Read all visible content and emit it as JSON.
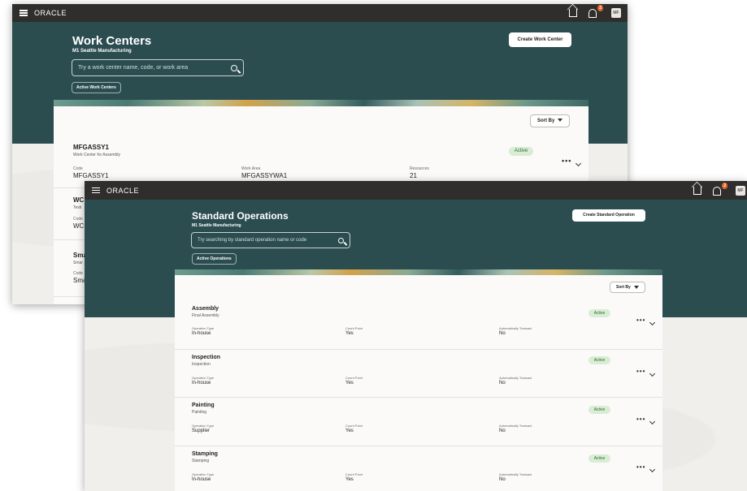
{
  "colors": {
    "topbar": "#2f2e2c",
    "hero": "#2b4d50",
    "active_bg": "#d9ecd5",
    "active_text": "#2e6b2a",
    "badge": "#e0632c"
  },
  "back": {
    "brand": "ORACLE",
    "notification_count": "2",
    "avatar": "MF",
    "title": "Work Centers",
    "subtitle": "M1 Seattle Manufacturing",
    "search_placeholder": "Try a work center name, code, or work area",
    "filter_chip": "Active Work Centers",
    "create_button": "Create Work Center",
    "sort_label": "Sort By",
    "row": {
      "name": "MFGASSY1",
      "desc": "Work Center for Assembly",
      "status": "Active",
      "code_label": "Code",
      "code": "MFGASSY1",
      "area_label": "Work Area",
      "area": "MFGASSYWA1",
      "res_label": "Resources",
      "res": "21"
    },
    "partials": [
      {
        "name": "WC",
        "desc": "Testi",
        "code_label": "Code",
        "code": "WC"
      },
      {
        "name": "Sma",
        "desc": "Smar",
        "code_label": "Code",
        "code": "Sma"
      }
    ]
  },
  "front": {
    "brand": "ORACLE",
    "notification_count": "2",
    "avatar": "MF",
    "title": "Standard Operations",
    "subtitle": "M1 Seattle Manufacturing",
    "search_placeholder": "Try searching by standard operation name or code",
    "filter_chip": "Active Operations",
    "create_button": "Create Standard Operation",
    "sort_label": "Sort By",
    "col_labels": {
      "type": "Operation Type",
      "count": "Count Point",
      "auto": "Automatically Transact"
    },
    "rows": [
      {
        "name": "Assembly",
        "desc": "Final Assembly",
        "status": "Active",
        "type": "In-house",
        "count": "Yes",
        "auto": "No"
      },
      {
        "name": "Inspection",
        "desc": "Inspection",
        "status": "Active",
        "type": "In-house",
        "count": "Yes",
        "auto": "No"
      },
      {
        "name": "Painting",
        "desc": "Painting",
        "status": "Active",
        "type": "Supplier",
        "count": "Yes",
        "auto": "No"
      },
      {
        "name": "Stamping",
        "desc": "Stamping",
        "status": "Active",
        "type": "In-house",
        "count": "Yes",
        "auto": "No"
      }
    ]
  }
}
